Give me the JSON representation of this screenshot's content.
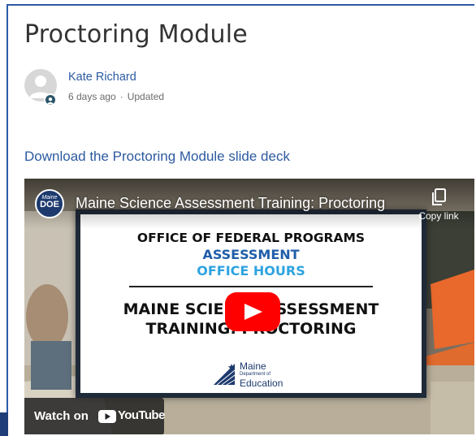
{
  "page": {
    "title": "Proctoring Module",
    "author": {
      "name": "Kate Richard",
      "time": "6 days ago",
      "separator": "·",
      "status": "Updated"
    },
    "download_link": "Download the Proctoring Module slide deck"
  },
  "video": {
    "title": "Maine Science Assessment Training: Proctoring",
    "copy_link_label": "Copy link",
    "channel_logo": {
      "top": "Maine",
      "bottom": "DOE"
    },
    "slide": {
      "line1": "OFFICE OF FEDERAL PROGRAMS",
      "line2": "ASSESSMENT",
      "line3": "OFFICE HOURS",
      "line4": "MAINE SCIENCE ASSESSMENT",
      "line5": "TRAINING: PROCTORING",
      "logo": {
        "maine": "Maine",
        "dept": "Department of",
        "education": "Education"
      }
    },
    "watch_on_label": "Watch on",
    "youtube_label": "YouTube"
  },
  "colors": {
    "link": "#2c5aa0",
    "frame": "#2b5aa8",
    "youtube_red": "#ff0000"
  },
  "icons": {
    "avatar": "user-avatar-icon",
    "badge": "user-badge-icon",
    "copy": "copy-icon",
    "play": "play-icon"
  }
}
